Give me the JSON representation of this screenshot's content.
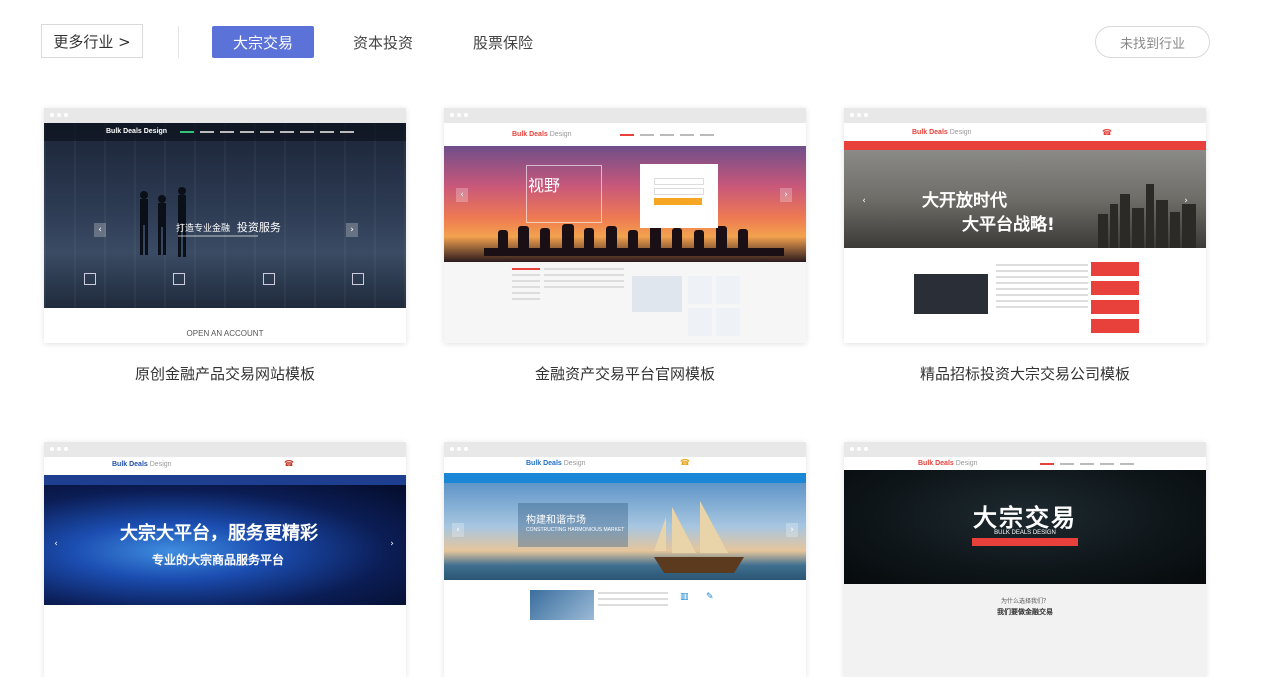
{
  "filter": {
    "more_label": "更多行业 >",
    "tabs": [
      {
        "label": "大宗交易",
        "active": true
      },
      {
        "label": "资本投资",
        "active": false
      },
      {
        "label": "股票保险",
        "active": false
      }
    ],
    "not_found_label": "未找到行业"
  },
  "colors": {
    "accent": "#5b73d9",
    "red": "#e8403a"
  },
  "cards": [
    {
      "caption": "原创金融产品交易网站模板",
      "logo_bold": "Bulk Deals Design",
      "hero_line": "打造专业金融",
      "hero_bold": "投资服务",
      "footer": "OPEN AN ACCOUNT"
    },
    {
      "caption": "金融资产交易平台官网模板",
      "logo_bold": "Bulk Deals",
      "logo_light": "Design",
      "hero_text": "视野"
    },
    {
      "caption": "精品招标投资大宗交易公司模板",
      "logo_bold": "Bulk Deals",
      "logo_light": "Design",
      "hero_line1": "大开放时代",
      "hero_line2": "大平台战略!"
    },
    {
      "caption": "",
      "logo_bold": "Bulk Deals",
      "logo_light": "Design",
      "hero_line1": "大宗大平台，服务更精彩",
      "hero_line2": "专业的大宗商品服务平台"
    },
    {
      "caption": "",
      "logo_bold": "Bulk Deals",
      "logo_light": "Design",
      "hero_line1": "构建和谐市场",
      "hero_line2": "CONSTRUCTING HARMONIOUS MARKET"
    },
    {
      "caption": "",
      "logo_bold": "Bulk Deals",
      "logo_light": "Design",
      "hero_title": "大宗交易",
      "hero_sub": "BULK DEALS DESIGN",
      "footer_line1": "为什么选择我们？",
      "footer_line2": "我们要做金融交易"
    }
  ]
}
